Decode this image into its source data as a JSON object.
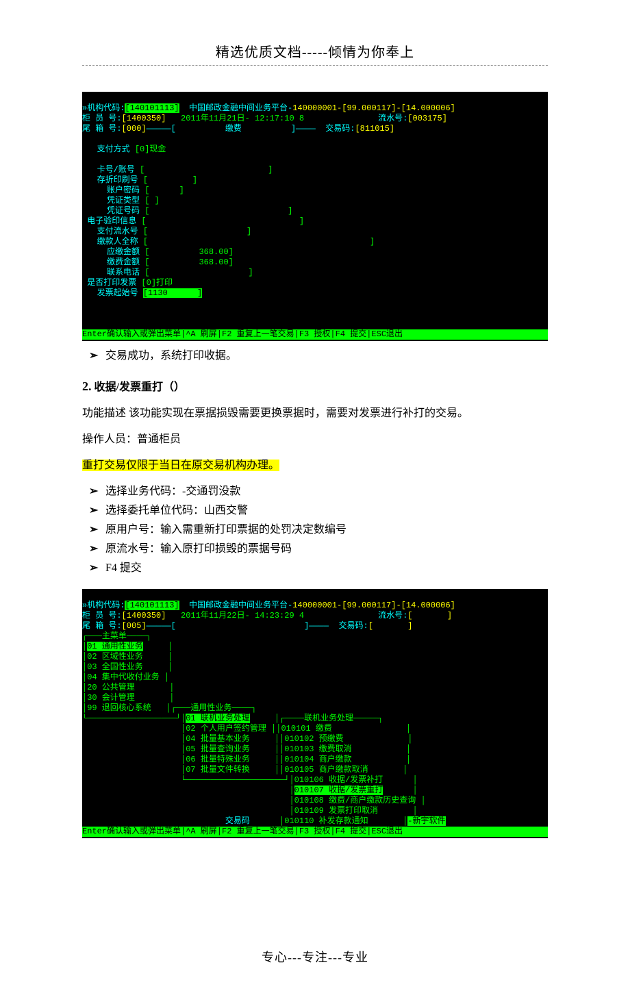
{
  "header": {
    "title": "精选优质文档-----倾情为你奉上"
  },
  "terminal1": {
    "line1_label": "»机构代码:",
    "line1_code": "[140101113]",
    "line1_mid": "  中国邮政金融中间业务平台-",
    "line1_right": "140000001-[99.000117]-[14.000006]",
    "line2_a": "柜 员 号:",
    "line2_b": "[1400350]",
    "line2_c": "   2011年11月21日- 12:17:10 8",
    "line2_d": "               流水号:",
    "line2_e": "[003175]",
    "line3_a": "尾 箱 号:",
    "line3_b": "[000]",
    "line3_c": "—————[          缴费          ]————  交易码:",
    "line3_d": "[811015]",
    "form": {
      "pay_label": "支付方式",
      "pay_val": "[0]现金",
      "card_label": "卡号/账号",
      "card_val": "[                         ]",
      "passbook_label": "存折印刷号",
      "passbook_val": "[         ]",
      "pwd_label": "账户密码",
      "pwd_val": "[      ]",
      "vtype_label": "凭证类型",
      "vtype_val": "[ ]",
      "vnum_label": "凭证号码",
      "vnum_val": "[                            ]",
      "einfo_label": "电子验印信息",
      "einfo_val": "[                               ]",
      "payflow_label": "支付流水号",
      "payflow_val": "[                    ]",
      "payer_label": "缴款人全称",
      "payer_val": "[                                             ]",
      "due_label": "应缴金额",
      "due_val": "[          368.00]",
      "paid_label": "缴费金额",
      "paid_val": "[          368.00]",
      "tel_label": "联系电话",
      "tel_val": "[                    ]",
      "print_label": "是否打印发票",
      "print_val": "[0]打印",
      "invstart_label": "发票起始号",
      "invstart_val": "[1130      ]"
    },
    "status": "Enter确认输入或弹出菜单|^A 刷屏|F2 重复上一笔交易|F3 授权|F4 提交|ESC退出   "
  },
  "after_t1_bullet": "交易成功，系统打印收据。",
  "section2": {
    "num": "2.",
    "title": "收据/发票重打（）",
    "desc1": "功能描述 该功能实现在票据损毁需要更换票据时，需要对发票进行补打的交易。",
    "desc2": "操作人员：普通柜员",
    "highlight": "重打交易仅限于当日在原交易机构办理。",
    "bullets": [
      "选择业务代码：-交通罚没款",
      "选择委托单位代码：山西交警",
      "原用户号：输入需重新打印票据的处罚决定数编号",
      "原流水号：输入原打印损毁的票据号码",
      "F4 提交"
    ]
  },
  "terminal2": {
    "line1_label": "»机构代码:",
    "line1_code": "[140101113]",
    "line1_mid": "  中国邮政金融中间业务平台-",
    "line1_right": "140000001-[99.000117]-[14.000006]",
    "line2_a": "柜 员 号:",
    "line2_b": "[1400350]",
    "line2_c": "   2011年11月22日- 14:23:29 4",
    "line2_d": "               流水号:",
    "line2_e": "[       ]",
    "line3_a": "尾 箱 号:",
    "line3_b": "[005]",
    "line3_c": "—————[                          ]————  交易码:",
    "line3_d": "[       ]",
    "mainmenu_title": "主菜单",
    "mainmenu": [
      "01 通用性业务",
      "02 区域性业务",
      "03 全国性业务",
      "04 集中代收付业务",
      "20 公共管理",
      "30 会计管理",
      "99 退回核心系统"
    ],
    "submenu_title": "通用性业务",
    "submenu": [
      "01 联机业务处理",
      "02 个人用户签约管理",
      "04 批量基本业务",
      "05 批量查询业务",
      "06 批量特殊业务",
      "07 批量文件转换"
    ],
    "submenu2_title": "联机业务处理",
    "submenu2": [
      "010101 缴费",
      "010102 预缴费",
      "010103 缴费取消",
      "010104 商户缴款",
      "010105 商户缴款取消",
      "010106 收据/发票补打",
      "010107 收据/发票重打",
      "010108 缴费/商户缴款历史查询",
      "010109 发票打印取消",
      "010110 补发存款通知"
    ],
    "trans_code_label": "交易码 ",
    "brand": "-新宇软件",
    "status": "Enter确认输入或弹出菜单|^A 刷屏|F2 重复上一笔交易|F3 授权|F4 提交|ESC退出"
  },
  "footer": "专心---专注---专业"
}
